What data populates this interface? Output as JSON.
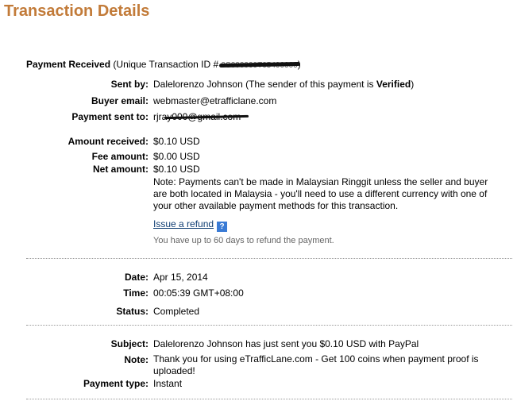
{
  "page_title": "Transaction Details",
  "payment_received": {
    "label": "Payment Received",
    "txn_prefix": "(Unique Transaction ID #",
    "txn_id": "9S000000T05400000",
    "txn_suffix": ")"
  },
  "sender": {
    "label": "Sent by:",
    "name": "Dalelorenzo Johnson",
    "status_prefix": "(The sender of this payment is",
    "status": "Verified",
    "status_suffix": ")"
  },
  "buyer_email": {
    "label": "Buyer email:",
    "value": "webmaster@etrafficlane.com"
  },
  "payment_sent_to": {
    "label": "Payment sent to:",
    "value": "rjray000@gmail.com"
  },
  "amounts": {
    "received_label": "Amount received:",
    "received_value": "$0.10 USD",
    "fee_label": "Fee amount:",
    "fee_value": "$0.00 USD",
    "net_label": "Net amount:",
    "net_value": "$0.10 USD",
    "note": "Note: Payments can't be made in Malaysian Ringgit unless the seller and buyer are both located in Malaysia - you'll need to use a different currency with one of your other available payment methods for this transaction."
  },
  "refund": {
    "link_label": "Issue a refund",
    "help_icon": "?",
    "note": "You have up to 60 days to refund the payment."
  },
  "details": {
    "date_label": "Date:",
    "date_value": "Apr 15, 2014",
    "time_label": "Time:",
    "time_value": "00:05:39 GMT+08:00",
    "status_label": "Status:",
    "status_value": "Completed"
  },
  "message": {
    "subject_label": "Subject:",
    "subject_value": "Dalelorenzo Johnson has just sent you $0.10 USD with PayPal",
    "note_label": "Note:",
    "note_value": "Thank you for using eTrafficLane.com - Get 100 coins when payment proof is uploaded!",
    "payment_type_label": "Payment type:",
    "payment_type_value": "Instant"
  },
  "colors": {
    "title": "#c27b39",
    "link": "#0e3d73",
    "help_icon_bg": "#3a7bd5"
  }
}
